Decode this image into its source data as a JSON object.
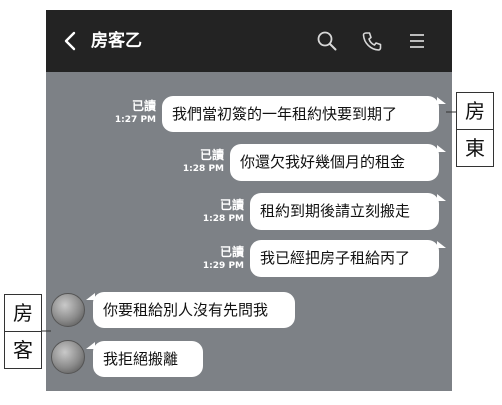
{
  "header": {
    "title": "房客乙",
    "icons": [
      "back-icon",
      "search-icon",
      "phone-icon",
      "menu-icon"
    ]
  },
  "messages": [
    {
      "side": "right",
      "read": "已讀",
      "time": "1:27 PM",
      "text": "我們當初簽的一年租約快要到期了"
    },
    {
      "side": "right",
      "read": "已讀",
      "time": "1:28 PM",
      "text": "你還欠我好幾個月的租金"
    },
    {
      "side": "right",
      "read": "已讀",
      "time": "1:28 PM",
      "text": "租約到期後請立刻搬走"
    },
    {
      "side": "right",
      "read": "已讀",
      "time": "1:29 PM",
      "text": "我已經把房子租給丙了"
    },
    {
      "side": "left",
      "text": "你要租給別人沒有先問我"
    },
    {
      "side": "left",
      "text": "我拒絕搬離"
    }
  ],
  "labels": {
    "landlord": [
      "房",
      "東"
    ],
    "tenant": [
      "房",
      "客"
    ]
  },
  "colors": {
    "topbar": "#232323",
    "chat_background": "#7d8186",
    "bubble": "#ffffff"
  }
}
